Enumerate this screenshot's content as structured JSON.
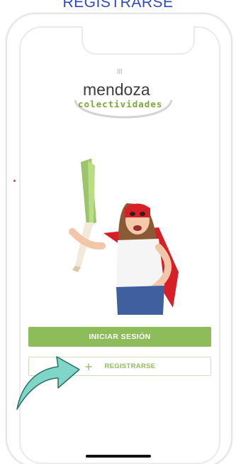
{
  "header": {
    "title": "REGISTRARSE"
  },
  "logo": {
    "steam": "≀≀≀",
    "top": "mendoza",
    "bottom": "colectividades"
  },
  "buttons": {
    "login_label": "INICIAR SESIÓN",
    "register_label": "REGISTRARSE",
    "register_icon": "+"
  },
  "colors": {
    "accent": "#8fbc5a",
    "title": "#2f49c4",
    "arrow": "#7fd6c8"
  }
}
